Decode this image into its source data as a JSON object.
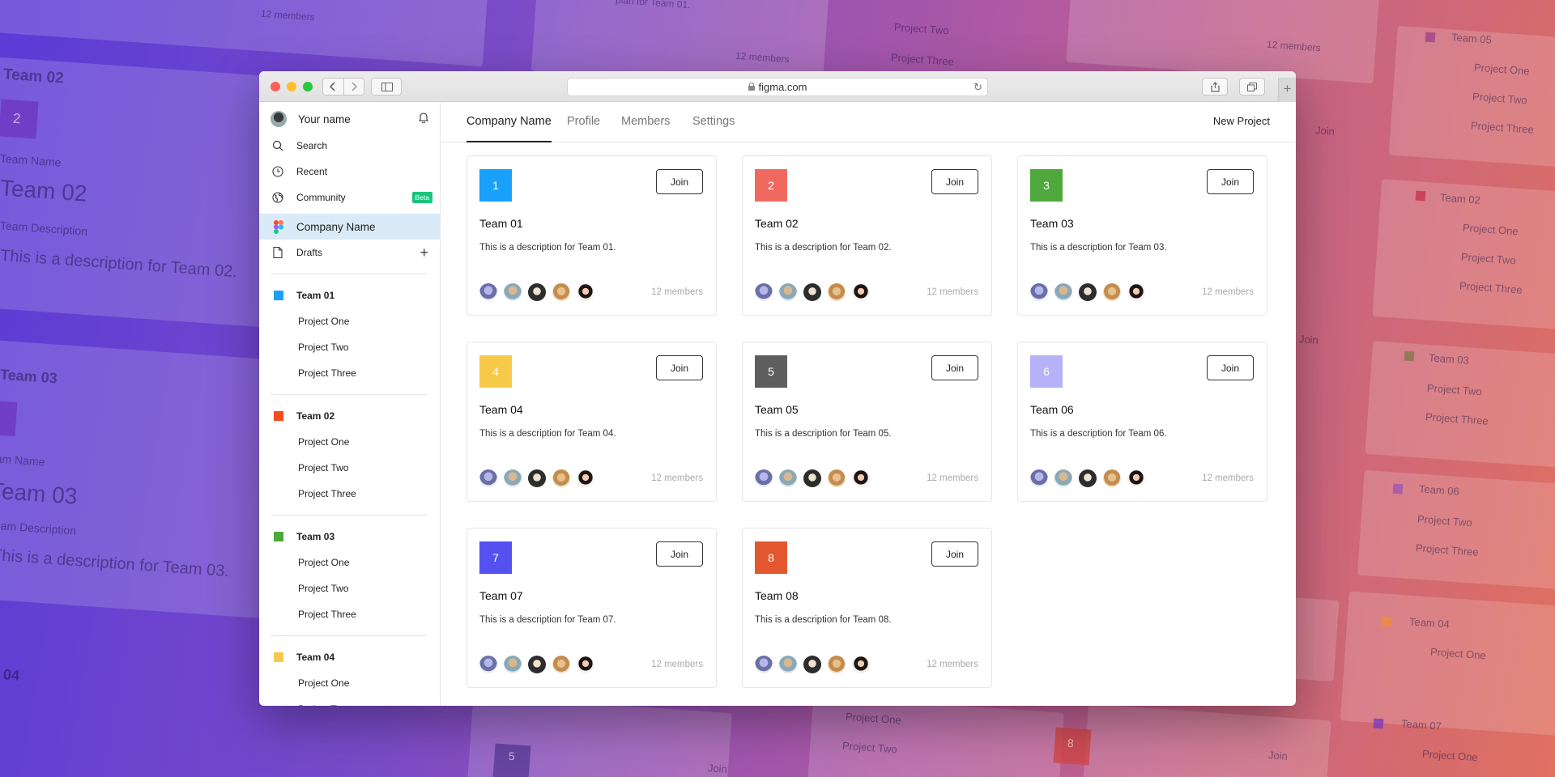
{
  "background": {
    "labels": [
      "Team 02",
      "2",
      "Team Name",
      "Team 02",
      "Team Description",
      "This is a description for Team 02.",
      "Team 03",
      "Team Name",
      "Team 03",
      "Team Description",
      "This is a description for Team 03.",
      "04",
      "Team 05",
      "Project One",
      "Project Two",
      "Project Three",
      "Team 02",
      "Project One",
      "Project Two",
      "Project Three",
      "Team 03",
      "Project Two",
      "Project Three",
      "Team 06",
      "Project Two",
      "Project Three",
      "Team 04",
      "Project One",
      "Team 07",
      "Project One",
      "Project Two",
      "Project Three",
      "Project One",
      "Project Two",
      "5",
      "Join",
      "8",
      "Join",
      "Join",
      "Join",
      "12 members",
      "12 members",
      "12 members",
      "plan for Team 01."
    ]
  },
  "browser": {
    "url": "figma.com",
    "icons": [
      "back-icon",
      "forward-icon",
      "sidebar-icon",
      "lock-icon",
      "reload-icon",
      "share-icon",
      "tabs-icon",
      "plus-icon"
    ]
  },
  "sidebar": {
    "user_name": "Your name",
    "search": "Search",
    "recent": "Recent",
    "community": "Community",
    "beta_badge": "Beta",
    "company": "Company Name",
    "drafts": "Drafts",
    "teams": [
      {
        "name": "Team 01",
        "color": "#18a0fb",
        "projects": [
          "Project One",
          "Project Two",
          "Project Three"
        ]
      },
      {
        "name": "Team 02",
        "color": "#f24e1e",
        "projects": [
          "Project One",
          "Project Two",
          "Project Three"
        ]
      },
      {
        "name": "Team 03",
        "color": "#4ea83c",
        "projects": [
          "Project One",
          "Project Two",
          "Project Three"
        ]
      },
      {
        "name": "Team 04",
        "color": "#f7c94a",
        "projects": [
          "Project One",
          "Project Two"
        ]
      }
    ]
  },
  "header": {
    "tabs": [
      "Company Name",
      "Profile",
      "Members",
      "Settings"
    ],
    "active_tab": "Company Name",
    "new_project": "New Project"
  },
  "cards": [
    {
      "number": "1",
      "color": "#18a0fb",
      "title": "Team 01",
      "description": "This is a description for Team 01.",
      "join": "Join",
      "members": "12 members"
    },
    {
      "number": "2",
      "color": "#f0695e",
      "title": "Team 02",
      "description": "This is a description for Team 02.",
      "join": "Join",
      "members": "12 members"
    },
    {
      "number": "3",
      "color": "#4ea83c",
      "title": "Team 03",
      "description": "This is a description for Team 03.",
      "join": "Join",
      "members": "12 members"
    },
    {
      "number": "4",
      "color": "#f7c94a",
      "title": "Team 04",
      "description": "This is a description for Team 04.",
      "join": "Join",
      "members": "12 members"
    },
    {
      "number": "5",
      "color": "#5e5e5e",
      "title": "Team 05",
      "description": "This is a description for Team 05.",
      "join": "Join",
      "members": "12 members"
    },
    {
      "number": "6",
      "color": "#b5b2f7",
      "title": "Team 06",
      "description": "This is a description for Team 06.",
      "join": "Join",
      "members": "12 members"
    },
    {
      "number": "7",
      "color": "#5551f0",
      "title": "Team 07",
      "description": "This is a description for Team 07.",
      "join": "Join",
      "members": "12 members"
    },
    {
      "number": "8",
      "color": "#e2572f",
      "title": "Team 08",
      "description": "This is a description for Team 08.",
      "join": "Join",
      "members": "12 members"
    }
  ]
}
